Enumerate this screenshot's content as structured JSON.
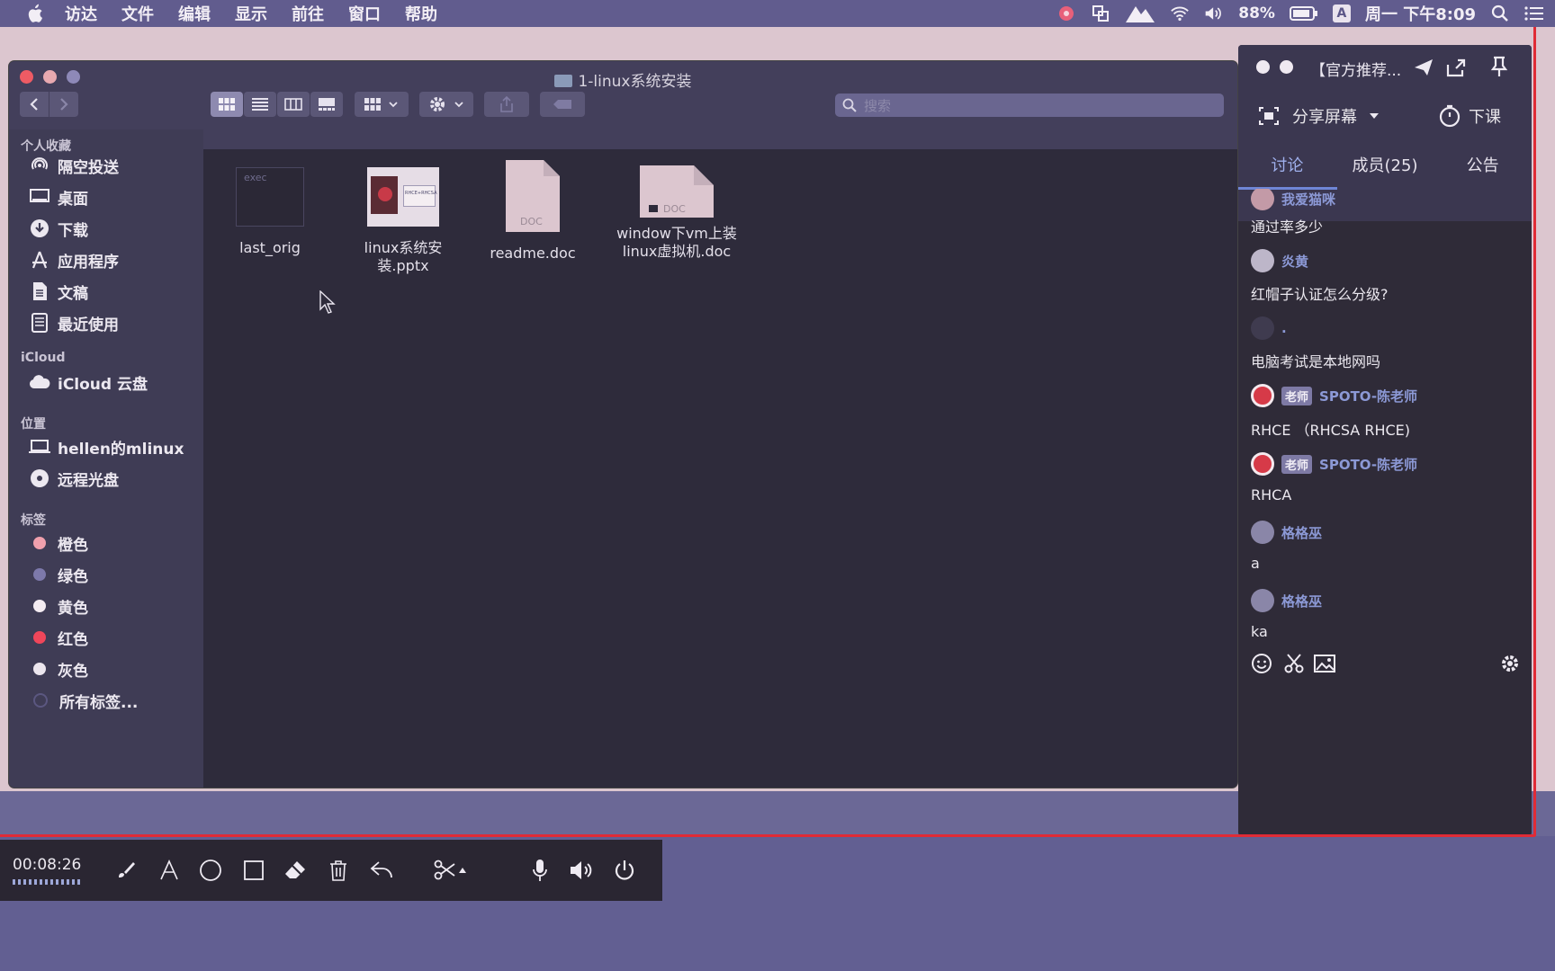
{
  "menubar": {
    "items": [
      "访达",
      "文件",
      "编辑",
      "显示",
      "前往",
      "窗口",
      "帮助"
    ],
    "battery": "88%",
    "ime": "A",
    "clock": "周一 下午8:09"
  },
  "finder": {
    "title": "1-linux系统安装",
    "search_placeholder": "搜索",
    "sidebar": {
      "favorites_header": "个人收藏",
      "favorites": [
        {
          "label": "隔空投送",
          "icon": "airdrop-icon"
        },
        {
          "label": "桌面",
          "icon": "desktop-icon"
        },
        {
          "label": "下载",
          "icon": "download-icon"
        },
        {
          "label": "应用程序",
          "icon": "applications-icon"
        },
        {
          "label": "文稿",
          "icon": "documents-icon"
        },
        {
          "label": "最近使用",
          "icon": "recents-icon"
        }
      ],
      "icloud_header": "iCloud",
      "icloud": [
        {
          "label": "iCloud 云盘",
          "icon": "cloud-icon"
        }
      ],
      "locations_header": "位置",
      "locations": [
        {
          "label": "hellen的mlinux",
          "icon": "laptop-icon"
        },
        {
          "label": "远程光盘",
          "icon": "disc-icon"
        }
      ],
      "tags_header": "标签",
      "tags": [
        {
          "label": "橙色",
          "color": "#f0a0ad"
        },
        {
          "label": "绿色",
          "color": "#7d79ab"
        },
        {
          "label": "黄色",
          "color": "#f4ecf2"
        },
        {
          "label": "红色",
          "color": "#f0465a"
        },
        {
          "label": "灰色",
          "color": "#ece6ee"
        },
        {
          "label": "所有标签...",
          "color": "#5b5780"
        }
      ]
    },
    "files": [
      {
        "name1": "last_orig",
        "name2": "",
        "thumb_text": "exec"
      },
      {
        "name1": "linux系统安",
        "name2": "装.pptx",
        "thumb_text": "RHCE+RHCSA"
      },
      {
        "name1": "readme.doc",
        "name2": "",
        "thumb_text": "DOC"
      },
      {
        "name1": "window下vm上装",
        "name2": "linux虚拟机.doc",
        "thumb_text": "DOC"
      }
    ]
  },
  "chat": {
    "title": "【官方推荐...",
    "share_label": "分享屏幕",
    "end_label": "下课",
    "tabs": [
      "讨论",
      "成员(25)",
      "公告"
    ],
    "messages": [
      {
        "sender": "我爱猫咪",
        "badge": "",
        "text": "通过率多少"
      },
      {
        "sender": "炎黄",
        "badge": "",
        "text": "红帽子认证怎么分级?"
      },
      {
        "sender": ".",
        "badge": "",
        "text": "电脑考试是本地网吗"
      },
      {
        "sender": "SPOTO-陈老师",
        "badge": "老师",
        "text": "RHCE （RHCSA   RHCE)"
      },
      {
        "sender": "SPOTO-陈老师",
        "badge": "老师",
        "text": "RHCA"
      },
      {
        "sender": "格格巫",
        "badge": "",
        "text": "a"
      },
      {
        "sender": "格格巫",
        "badge": "",
        "text": "ka"
      }
    ]
  },
  "recorder": {
    "time": "00:08:26"
  },
  "colors": {
    "accent_red": "#e02b36",
    "chat_active_tab": "#9fb0ec"
  }
}
